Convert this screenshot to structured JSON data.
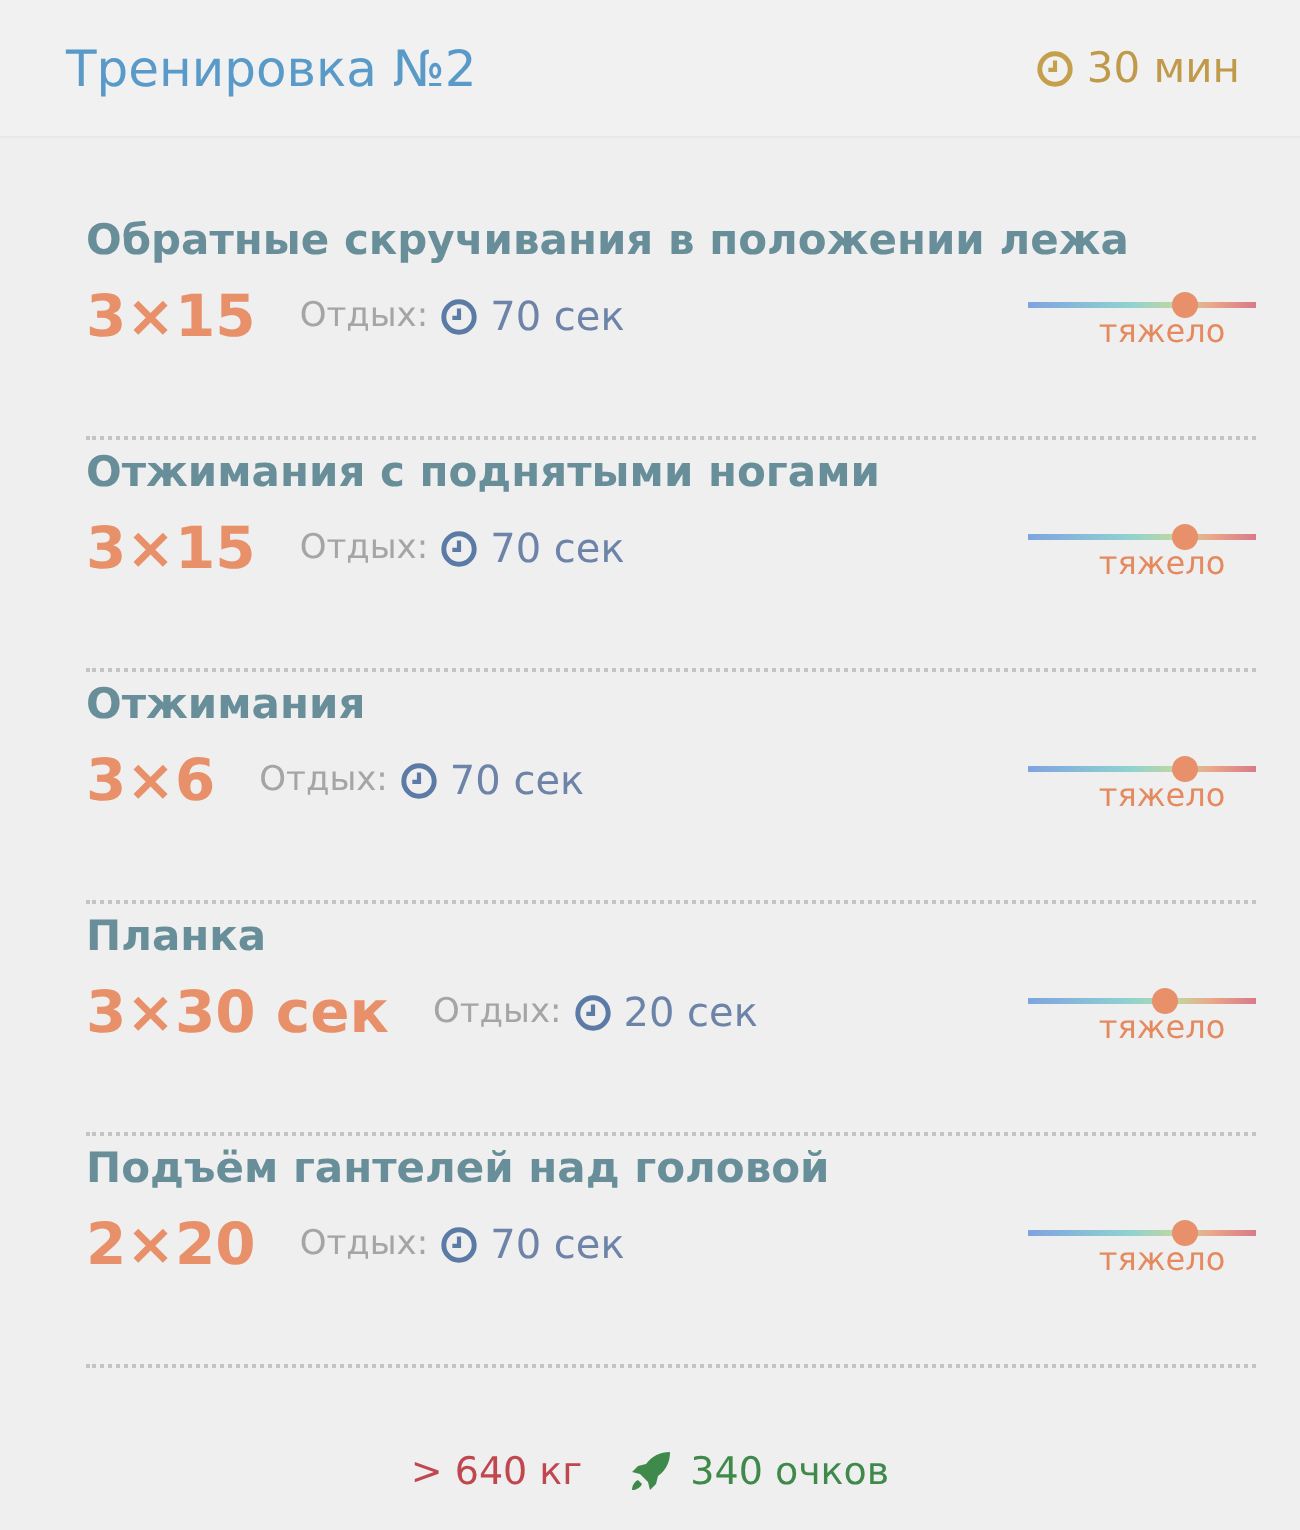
{
  "header": {
    "title": "Тренировка №2",
    "duration": "30 мин"
  },
  "exercises": [
    {
      "name": "Обратные скручивания в положении лежа",
      "sets": "3×15",
      "rest_label": "Отдых:",
      "rest": "70 сек",
      "level": 0.68,
      "difficulty": "тяжело"
    },
    {
      "name": "Отжимания с поднятыми ногами",
      "sets": "3×15",
      "rest_label": "Отдых:",
      "rest": "70 сек",
      "level": 0.68,
      "difficulty": "тяжело"
    },
    {
      "name": "Отжимания",
      "sets": "3×6",
      "rest_label": "Отдых:",
      "rest": "70 сек",
      "level": 0.68,
      "difficulty": "тяжело"
    },
    {
      "name": "Планка",
      "sets": "3×30 сек",
      "rest_label": "Отдых:",
      "rest": "20 сек",
      "level": 0.6,
      "difficulty": "тяжело"
    },
    {
      "name": "Подъём гантелей над головой",
      "sets": "2×20",
      "rest_label": "Отдых:",
      "rest": "70 сек",
      "level": 0.68,
      "difficulty": "тяжело"
    }
  ],
  "footer": {
    "weight": "> 640 кг",
    "points": "340 очков"
  }
}
